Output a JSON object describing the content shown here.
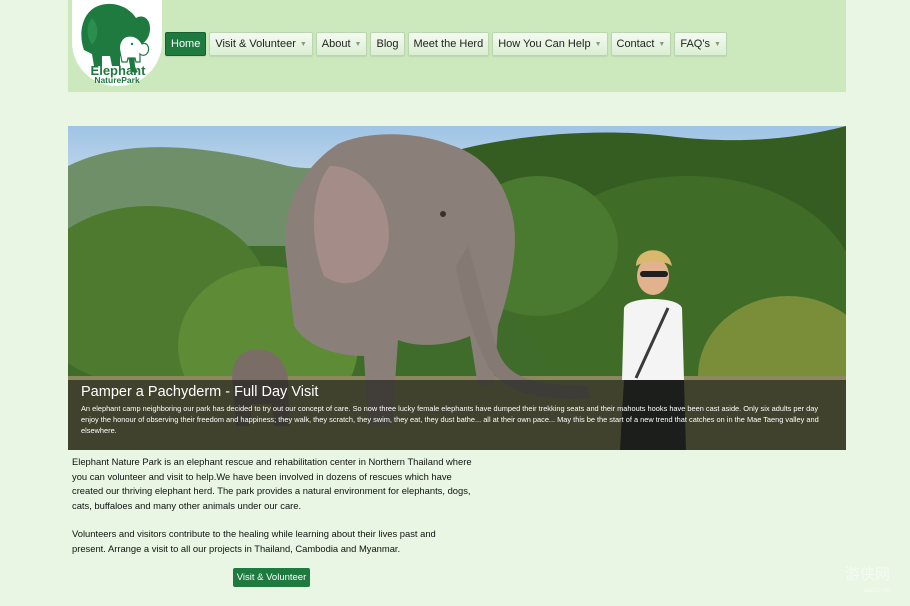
{
  "logo": {
    "line1": "Elephant",
    "line2": "NaturePark",
    "brand_color": "#1e7a3f"
  },
  "nav": {
    "items": [
      {
        "label": "Home",
        "active": true,
        "has_dropdown": false
      },
      {
        "label": "Visit & Volunteer",
        "has_dropdown": true
      },
      {
        "label": "About",
        "has_dropdown": true
      },
      {
        "label": "Blog",
        "has_dropdown": false
      },
      {
        "label": "Meet the Herd",
        "has_dropdown": false
      },
      {
        "label": "How You Can Help",
        "has_dropdown": true
      },
      {
        "label": "Contact",
        "has_dropdown": true
      },
      {
        "label": "FAQ's",
        "has_dropdown": true
      }
    ],
    "chevron_icon": "chevron-down-icon"
  },
  "hero": {
    "title": "Pamper a Pachyderm - Full Day Visit",
    "text": "An elephant camp neighboring our park has decided to try out our concept of care. So now three lucky female elephants have dumped their trekking seats and their mahouts hooks have been cast aside. Only six adults per day enjoy the honour of observing their freedom and happiness; they walk, they scratch, they swim, they eat, they dust bathe... all at their own pace... May this be the start of a new trend that catches on in the Mae Taeng valley and elsewhere."
  },
  "content": {
    "paragraph1": "Elephant Nature Park is an elephant rescue and rehabilitation center in Northern Thailand where you can volunteer and visit to help.We have been involved in dozens of rescues which have created our thriving elephant herd. The park provides a natural environment for elephants, dogs, cats, buffaloes and many other animals under our care.",
    "paragraph2": "Volunteers and visitors contribute to the healing while learning about their lives past and present. Arrange a visit to all our projects in Thailand, Cambodia and Myanmar.",
    "cta_label": "Visit & Volunteer"
  },
  "watermark": {
    "text": "游侠网",
    "sub": "ali213.net"
  }
}
